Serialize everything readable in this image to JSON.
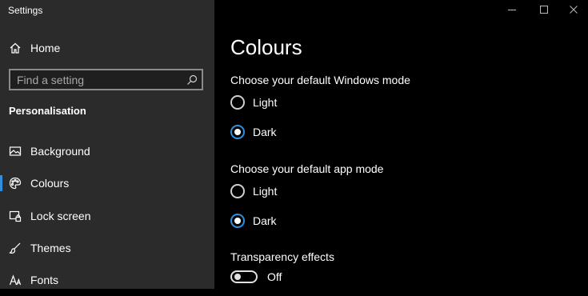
{
  "window": {
    "title": "Settings",
    "controls": [
      "minimize-icon",
      "maximize-icon",
      "close-icon"
    ]
  },
  "sidebar": {
    "home_label": "Home",
    "search_placeholder": "Find a setting",
    "section_heading": "Personalisation",
    "items": [
      {
        "label": "Background",
        "icon": "background-image-icon",
        "selected": false
      },
      {
        "label": "Colours",
        "icon": "palette-icon",
        "selected": true
      },
      {
        "label": "Lock screen",
        "icon": "lock-screen-icon",
        "selected": false
      },
      {
        "label": "Themes",
        "icon": "paintbrush-icon",
        "selected": false
      },
      {
        "label": "Fonts",
        "icon": "fonts-icon",
        "selected": false
      }
    ]
  },
  "main": {
    "title": "Colours",
    "windows_mode": {
      "label": "Choose your default Windows mode",
      "options": [
        "Light",
        "Dark"
      ],
      "selected": "Dark"
    },
    "app_mode": {
      "label": "Choose your default app mode",
      "options": [
        "Light",
        "Dark"
      ],
      "selected": "Dark"
    },
    "transparency": {
      "label": "Transparency effects",
      "state": "Off"
    }
  },
  "colors": {
    "accent": "#2f8fdc",
    "sidebar_bg": "#2b2b2b",
    "content_bg": "#000000"
  }
}
